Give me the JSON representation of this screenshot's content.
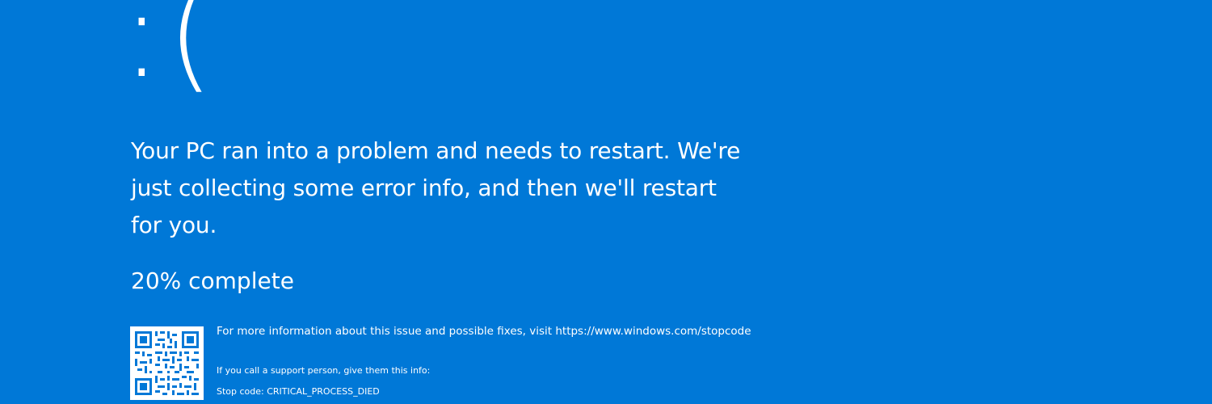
{
  "screen": {
    "background_color": "#0078d7",
    "text_color": "#ffffff",
    "sad_face": ":(",
    "headline": "Your PC ran into a problem and needs to restart. We're just collecting some error info, and then we'll restart for you.",
    "progress_text": "20% complete",
    "progress_fraction": 0.2,
    "qr_code_icon": "qr-code-icon",
    "more_info": "For more information about this issue and possible fixes, visit https://www.windows.com/stopcode",
    "support_text": "If you call a support person, give them this info:",
    "stop_code": "Stop code: CRITICAL_PROCESS_DIED"
  }
}
